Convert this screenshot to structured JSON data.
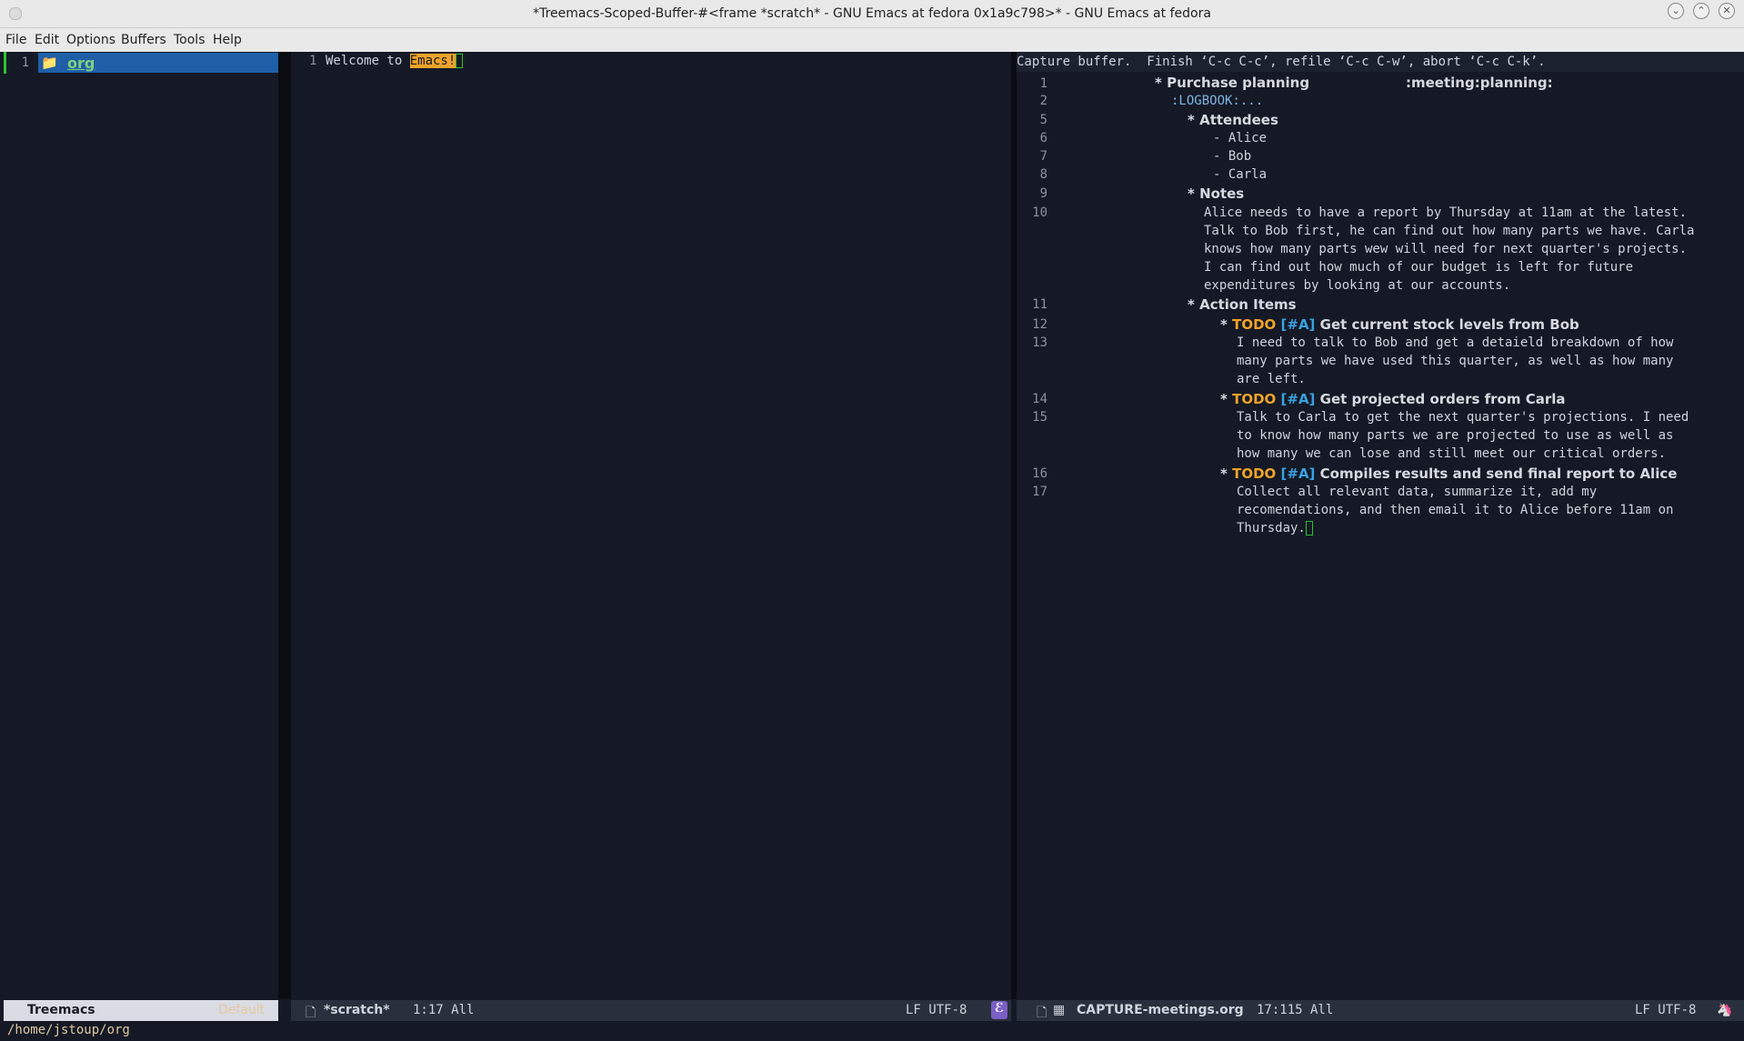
{
  "window": {
    "title": "*Treemacs-Scoped-Buffer-#<frame *scratch* - GNU Emacs at fedora 0x1a9c798>* - GNU Emacs at fedora"
  },
  "menu": [
    "File",
    "Edit",
    "Options",
    "Buffers",
    "Tools",
    "Help"
  ],
  "treemacs": {
    "line_number": "1",
    "item_label": "org",
    "modeline_name": "Treemacs",
    "modeline_workspace": "Default"
  },
  "scratch": {
    "line_number": "1",
    "text_prefix": "Welcome to ",
    "text_highlight": "Emacs!",
    "modeline_buffer": "*scratch*",
    "modeline_position": "1:17 All",
    "modeline_encoding": "LF UTF-8"
  },
  "capture": {
    "header": "Capture buffer.  Finish ‘C-c C-c’, refile ‘C-c C-w’, abort ‘C-c C-k’.",
    "heading_star": "*",
    "line_numbers": [
      "1",
      "2",
      "5",
      "6",
      "7",
      "8",
      "9",
      "10",
      "11",
      "12",
      "13",
      "14",
      "15",
      "16",
      "17"
    ],
    "title": "Purchase planning",
    "tags": ":meeting:planning:",
    "logbook": ":LOGBOOK:...",
    "attendees_heading": "Attendees",
    "attendees": [
      "- Alice",
      "- Bob",
      "- Carla"
    ],
    "notes_heading": "Notes",
    "notes_lines": [
      "Alice needs to have a report by Thursday at 11am at the latest.",
      "Talk to Bob first, he can find out how many parts we have. Carla",
      "knows how many parts wew will need for next quarter's projects.",
      "I can find out how much of our budget is left for future",
      "expenditures by looking at our accounts."
    ],
    "action_heading": "Action Items",
    "todo_keyword": "TODO",
    "priority": "[#A]",
    "todos": [
      {
        "title": "Get current stock levels from Bob",
        "body": [
          "I need to talk to Bob and get a detaield breakdown of how",
          "many parts we have used this quarter, as well as how many",
          "are left."
        ]
      },
      {
        "title": "Get projected orders from Carla",
        "body": [
          "Talk to Carla to get the next quarter's projections. I need",
          "to know how many parts we are projected to use as well as",
          "how many we can lose and still meet our critical orders."
        ]
      },
      {
        "title": "Compiles results and send final report to Alice",
        "body": [
          "Collect all relevant data, summarize it, add my",
          "recomendations, and then email it to Alice before 11am on",
          "Thursday."
        ]
      }
    ],
    "modeline_buffer": "CAPTURE-meetings.org",
    "modeline_position": "17:115 All",
    "modeline_encoding": "LF UTF-8"
  },
  "echo_area": "/home/jstoup/org",
  "colors": {
    "background": "#141925",
    "todo": "#f0a32a",
    "priority": "#3aa0e0",
    "selection": "#1f5fa8",
    "cursor": "#2ec42e"
  }
}
